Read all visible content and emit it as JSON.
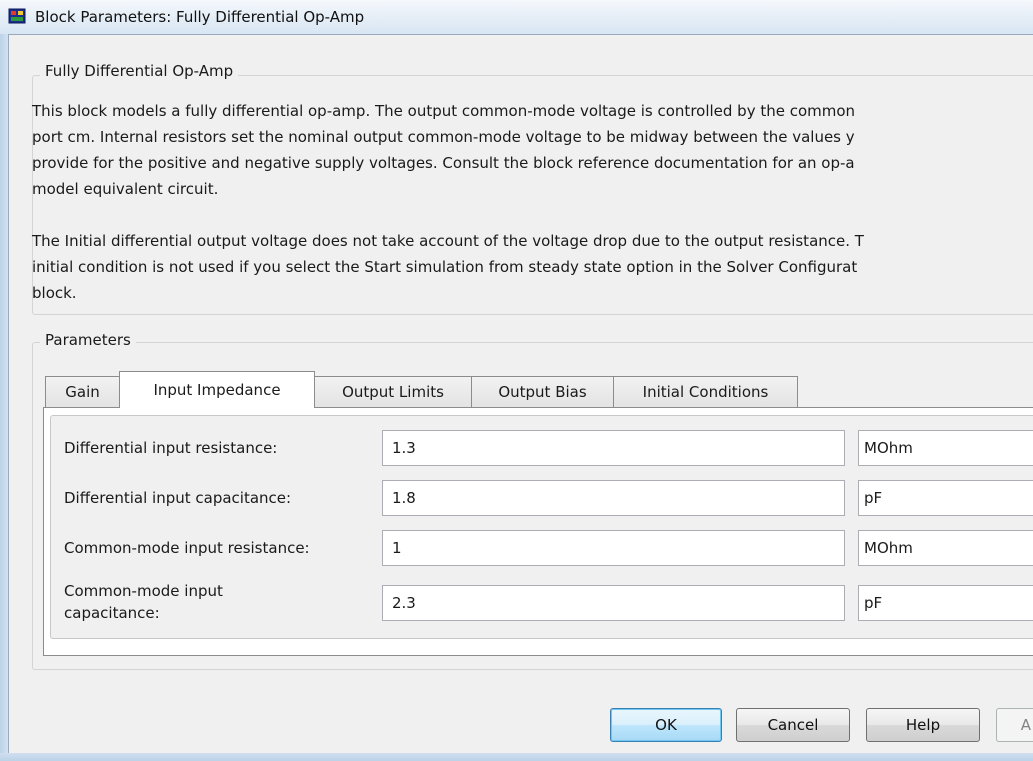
{
  "window": {
    "title": "Block Parameters: Fully Differential Op-Amp"
  },
  "description_group": {
    "legend": "Fully Differential Op-Amp",
    "lines": [
      "This block models a fully differential op-amp. The output common-mode voltage is controlled by the common",
      "port cm. Internal resistors set the nominal output common-mode voltage to be midway between the values y",
      "provide for the positive and negative supply voltages. Consult the block reference documentation for an op-a",
      "model equivalent circuit.",
      "",
      "The Initial differential output voltage does not take account of the voltage drop due to the output resistance. T",
      "initial condition is not used if you select the Start simulation from steady state option in the Solver Configurat",
      "block."
    ]
  },
  "parameters_group": {
    "legend": "Parameters",
    "tabs": [
      {
        "label": "Gain",
        "active": false
      },
      {
        "label": "Input Impedance",
        "active": true
      },
      {
        "label": "Output Limits",
        "active": false
      },
      {
        "label": "Output Bias",
        "active": false
      },
      {
        "label": "Initial Conditions",
        "active": false
      }
    ],
    "rows": [
      {
        "label": "Differential input resistance:",
        "value": "1.3",
        "unit": "MOhm"
      },
      {
        "label": "Differential input capacitance:",
        "value": "1.8",
        "unit": "pF"
      },
      {
        "label": "Common-mode input resistance:",
        "value": "1",
        "unit": "MOhm"
      },
      {
        "label_line1": "Common-mode input",
        "label_line2": "capacitance:",
        "value": "2.3",
        "unit": "pF"
      }
    ]
  },
  "buttons": {
    "ok": "OK",
    "cancel": "Cancel",
    "help": "Help",
    "apply_partial": "A"
  },
  "colors": {
    "window_frame": "#c4d8ec",
    "dialog_bg": "#f0f0f0",
    "default_button_border": "#3c7fb1"
  }
}
